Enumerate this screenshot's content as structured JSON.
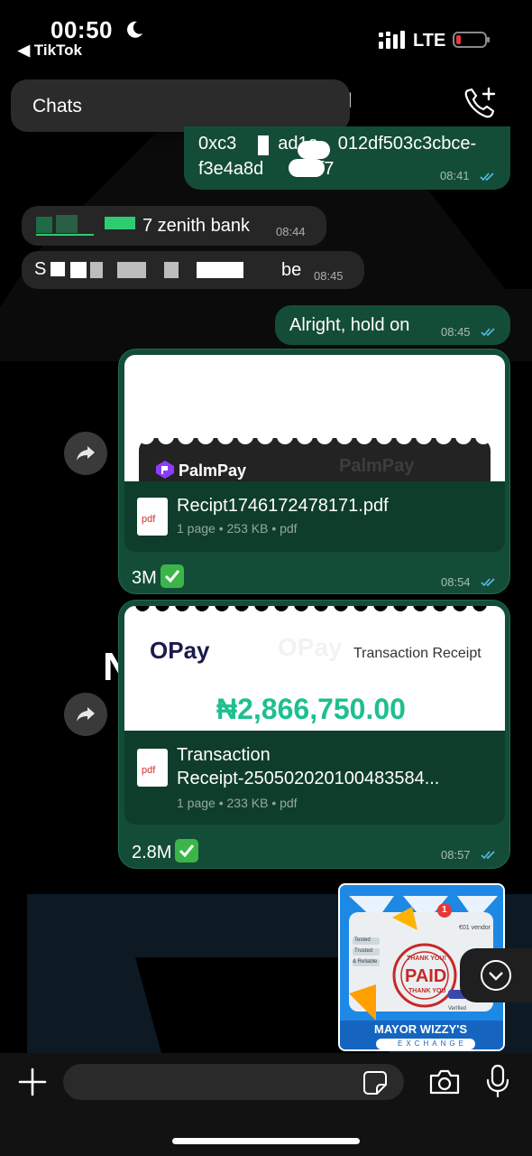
{
  "status_bar": {
    "time": "00:50",
    "back_app": "◀ TikTok",
    "network": "LTE"
  },
  "header": {
    "chats_label": "Chats",
    "partial_title": "I"
  },
  "messages": [
    {
      "dir": "out",
      "text_line1": "0xc3",
      "text_line1_mid": "ad1e",
      "text_line1_end": "012df503c3cbce-",
      "text_line2": "f3e4a8d",
      "text_line2_end": "49ff7",
      "time": "08:41"
    },
    {
      "dir": "in",
      "text_end": "7 zenith bank",
      "time": "08:44"
    },
    {
      "dir": "in",
      "text_start": "S",
      "text_end": "be",
      "time": "08:45"
    },
    {
      "dir": "out",
      "text": "Alright, hold on",
      "time": "08:45"
    },
    {
      "dir": "out",
      "type": "document",
      "brand": "PalmPay",
      "watermark": "PalmPay",
      "file_name": "Recipt1746172478171.pdf",
      "meta": "1 page • 253 KB • pdf",
      "caption": "3M",
      "time": "08:54"
    },
    {
      "dir": "out",
      "type": "document",
      "brand": "OPay",
      "watermark": "OPay",
      "heading": "Transaction Receipt",
      "amount": "₦2,866,750.00",
      "file_name_line1": "Transaction",
      "file_name_line2": "Receipt-250502020100483584...",
      "meta": "1 page • 233 KB • pdf",
      "caption": "2.8M",
      "time": "08:57"
    }
  ],
  "pdf_label": "pdf",
  "bg_letter": "N",
  "incoming_image": {
    "top_label": "€01 vendor",
    "tags": [
      "Tested",
      "Trusted",
      "& Reliable"
    ],
    "stamp_top": "THANK YOU!",
    "stamp": "PAID",
    "stamp_bottom": "THANK YOU",
    "verified": "Verified",
    "badge_count": "1",
    "title": "MAYOR WIZZY'S",
    "subtitle": "EXCHANGE"
  },
  "colors": {
    "outgoing_bubble": "#144d37",
    "incoming_bubble": "#262626",
    "read_tick": "#53bdeb",
    "opay_green": "#1dc08f"
  }
}
